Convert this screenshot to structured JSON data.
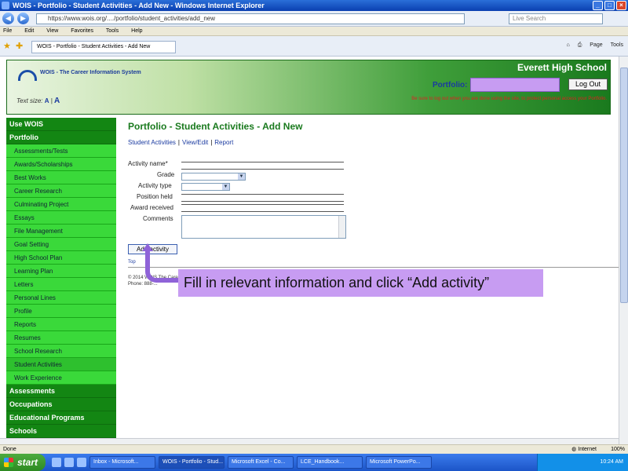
{
  "window": {
    "title": "WOIS - Portfolio - Student Activities - Add New - Windows Internet Explorer"
  },
  "addressbar": {
    "url": "https://www.wois.org/..../portfolio/student_activities/add_new",
    "search_placeholder": "Live Search"
  },
  "menubar": {
    "items": [
      "File",
      "Edit",
      "View",
      "Favorites",
      "Tools",
      "Help"
    ]
  },
  "tabbar": {
    "tab_label": "WOIS - Portfolio - Student Activities - Add New",
    "tools": [
      "Page",
      "Tools"
    ]
  },
  "header": {
    "logo_text": "WOIS - The Career Information System",
    "text_size_label": "Text size:",
    "text_size_options": [
      "A",
      "A"
    ],
    "school": "Everett High School",
    "portfolio_label": "Portfolio:",
    "logout_label": "Log Out",
    "warning": "Be sure to log out when you are done using the site, to protect personal access your Portfolio."
  },
  "sidebar": {
    "sections": [
      {
        "label": "Use WOIS"
      },
      {
        "label": "Portfolio",
        "items": [
          "Assessments/Tests",
          "Awards/Scholarships",
          "Best Works",
          "Career Research",
          "Culminating Project",
          "Essays",
          "File Management",
          "Goal Setting",
          "High School Plan",
          "Learning Plan",
          "Letters",
          "Personal Lines",
          "Profile",
          "Reports",
          "Resumes",
          "School Research",
          "Student Activities",
          "Work Experience"
        ],
        "active": "Student Activities"
      },
      {
        "label": "Assessments"
      },
      {
        "label": "Occupations"
      },
      {
        "label": "Educational Programs"
      },
      {
        "label": "Schools"
      }
    ]
  },
  "content": {
    "title": "Portfolio - Student Activities - Add New",
    "tabs": [
      "Student Activities",
      "View/Edit",
      "Report"
    ],
    "form": {
      "activity_name": "Activity name*",
      "grade": "Grade",
      "activity_type": "Activity type",
      "position_held": "Position held",
      "award_received": "Award received",
      "comments": "Comments"
    },
    "add_button": "Add activity",
    "top_link": "Top",
    "copyright": "© 2014 WOIS The Career Information System",
    "phone": "Phone: 888-..."
  },
  "callout": {
    "text": "Fill in relevant information and click “Add activity”",
    "color": "#c79cf2"
  },
  "statusbar": {
    "left": "Done",
    "zone": "Internet",
    "zoom": "100%"
  },
  "taskbar": {
    "start": "start",
    "tasks": [
      "Inbox - Microsoft...",
      "WOIS - Portfolio - Stud...",
      "Microsoft Excel - Co...",
      "LCE_Handbook...",
      "Microsoft PowerPo..."
    ],
    "clock": "10:24 AM"
  }
}
